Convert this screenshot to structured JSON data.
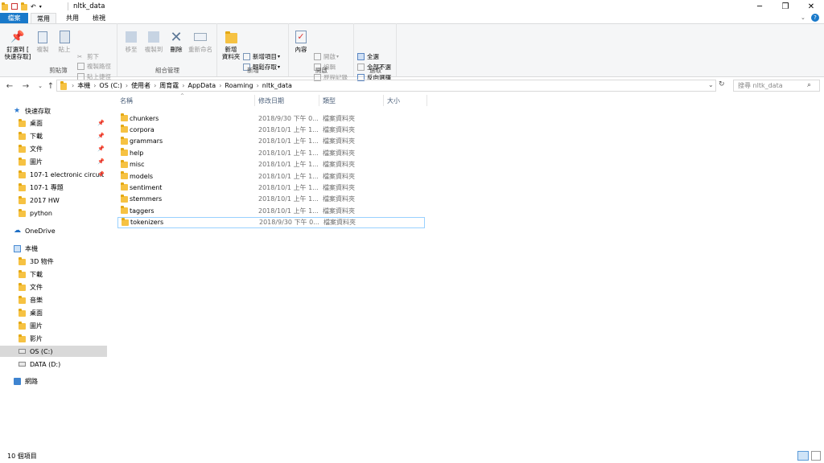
{
  "window": {
    "title": "nltk_data",
    "minimize": "─",
    "maximize": "❐",
    "close": "✕"
  },
  "tabs": {
    "file": "檔案",
    "home": "常用",
    "share": "共用",
    "view": "檢視"
  },
  "ribbon": {
    "clipboard": {
      "pin": "釘選到 [",
      "pin2": "快速存取]",
      "copy": "複製",
      "paste": "貼上",
      "cut": "剪下",
      "copy_path": "複製路徑",
      "paste_shortcut": "貼上捷徑",
      "label": "剪貼簿"
    },
    "organize": {
      "move_to": "移至",
      "copy_to": "複製到",
      "delete": "刪除",
      "rename": "重新命名",
      "label": "組合管理"
    },
    "new": {
      "new_folder": "新增",
      "new_folder2": "資料夾",
      "new_item": "新增項目",
      "easy_access": "輕鬆存取",
      "label": "新增"
    },
    "open": {
      "properties": "內容",
      "open": "開啟",
      "edit": "編輯",
      "history": "歷程記錄",
      "label": "開啟"
    },
    "select": {
      "select_all": "全選",
      "select_none": "全部不選",
      "invert": "反向選擇",
      "label": "選取"
    }
  },
  "address": {
    "crumbs": [
      "本機",
      "OS (C:)",
      "使用者",
      "周育霆",
      "AppData",
      "Roaming",
      "nltk_data"
    ],
    "search_placeholder": "搜尋 nltk_data"
  },
  "nav": {
    "quick_access": "快速存取",
    "quick_items": [
      {
        "label": "桌面",
        "pinned": true
      },
      {
        "label": "下載",
        "pinned": true
      },
      {
        "label": "文件",
        "pinned": true
      },
      {
        "label": "圖片",
        "pinned": true
      },
      {
        "label": "107-1 electronic circuit",
        "pinned": true
      },
      {
        "label": "107-1 專題",
        "pinned": false
      },
      {
        "label": "2017 HW",
        "pinned": false
      },
      {
        "label": "python",
        "pinned": false
      }
    ],
    "onedrive": "OneDrive",
    "this_pc": "本機",
    "pc_items": [
      "3D 物件",
      "下載",
      "文件",
      "音樂",
      "桌面",
      "圖片",
      "影片",
      "OS (C:)",
      "DATA (D:)"
    ],
    "network": "網路"
  },
  "columns": {
    "name": "名稱",
    "date": "修改日期",
    "type": "類型",
    "size": "大小"
  },
  "files": [
    {
      "name": "chunkers",
      "date": "2018/9/30 下午 0...",
      "type": "檔案資料夾"
    },
    {
      "name": "corpora",
      "date": "2018/10/1 上午 1...",
      "type": "檔案資料夾"
    },
    {
      "name": "grammars",
      "date": "2018/10/1 上午 1...",
      "type": "檔案資料夾"
    },
    {
      "name": "help",
      "date": "2018/10/1 上午 1...",
      "type": "檔案資料夾"
    },
    {
      "name": "misc",
      "date": "2018/10/1 上午 1...",
      "type": "檔案資料夾"
    },
    {
      "name": "models",
      "date": "2018/10/1 上午 1...",
      "type": "檔案資料夾"
    },
    {
      "name": "sentiment",
      "date": "2018/10/1 上午 1...",
      "type": "檔案資料夾"
    },
    {
      "name": "stemmers",
      "date": "2018/10/1 上午 1...",
      "type": "檔案資料夾"
    },
    {
      "name": "taggers",
      "date": "2018/10/1 上午 1...",
      "type": "檔案資料夾"
    },
    {
      "name": "tokenizers",
      "date": "2018/9/30 下午 0...",
      "type": "檔案資料夾"
    }
  ],
  "status": {
    "count": "10 個項目"
  }
}
